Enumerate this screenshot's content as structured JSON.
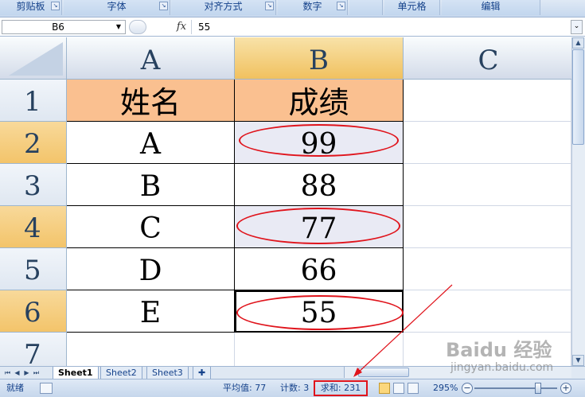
{
  "ribbon": {
    "groups": [
      "剪贴板",
      "字体",
      "对齐方式",
      "数字",
      "",
      "单元格",
      "编辑"
    ]
  },
  "formula_bar": {
    "name_box": "B6",
    "fx_label": "fx",
    "content": "55"
  },
  "grid": {
    "columns": [
      "A",
      "B",
      "C"
    ],
    "rows": [
      "1",
      "2",
      "3",
      "4",
      "5",
      "6",
      "7"
    ],
    "header": {
      "name": "姓名",
      "score": "成绩"
    },
    "records": [
      {
        "name": "A",
        "score": "99"
      },
      {
        "name": "B",
        "score": "88"
      },
      {
        "name": "C",
        "score": "77"
      },
      {
        "name": "D",
        "score": "66"
      },
      {
        "name": "E",
        "score": "55"
      }
    ]
  },
  "sheets": [
    "Sheet1",
    "Sheet2",
    "Sheet3"
  ],
  "status": {
    "ready": "就绪",
    "average": "平均值: 77",
    "count": "计数: 3",
    "sum": "求和: 231",
    "zoom": "295%"
  },
  "watermark": {
    "logo": "Baidu 经验",
    "url": "jingyan.baidu.com"
  },
  "colors": {
    "header_fill": "#fac090",
    "selected_fill": "#e9eaf4",
    "annotation_red": "#e0141c"
  }
}
